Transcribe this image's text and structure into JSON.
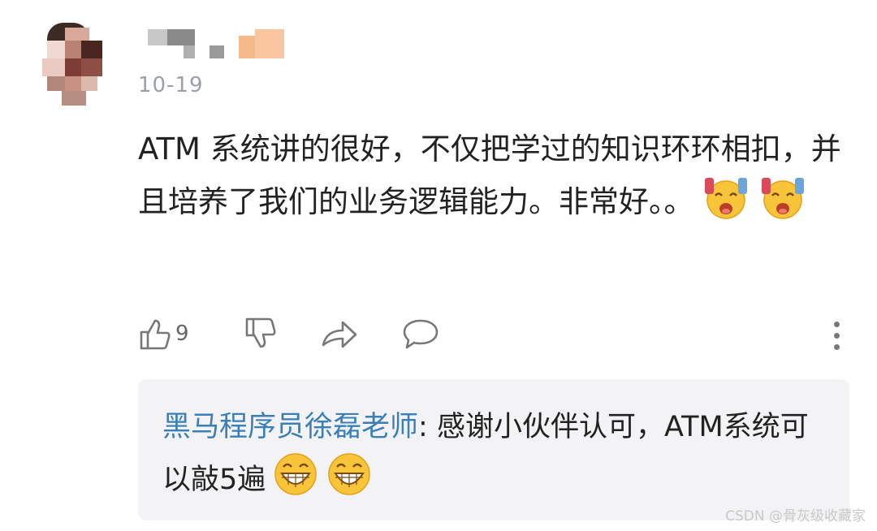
{
  "comment": {
    "date": "10-19",
    "text": "ATM 系统讲的很好，不仅把学过的知识环环相扣，并且培养了我们的业务逻辑能力。非常好。。",
    "emoji_name": "cheering-face-emoji",
    "like_count": "9"
  },
  "actions": {
    "like_icon": "thumbs-up-icon",
    "dislike_icon": "thumbs-down-icon",
    "share_icon": "share-icon",
    "reply_icon": "comment-bubble-icon",
    "more_icon": "more-vertical-icon"
  },
  "reply": {
    "author": "黑马程序员徐磊老师",
    "separator": ": ",
    "text": "感谢小伙伴认可，ATM系统可以敲5遍",
    "emoji_name": "grinning-face-emoji"
  },
  "watermark": "CSDN @骨灰级收藏家",
  "colors": {
    "author_link": "#3a7fb8",
    "reply_bg": "#f3f3f5",
    "icon_gray": "#777777"
  }
}
